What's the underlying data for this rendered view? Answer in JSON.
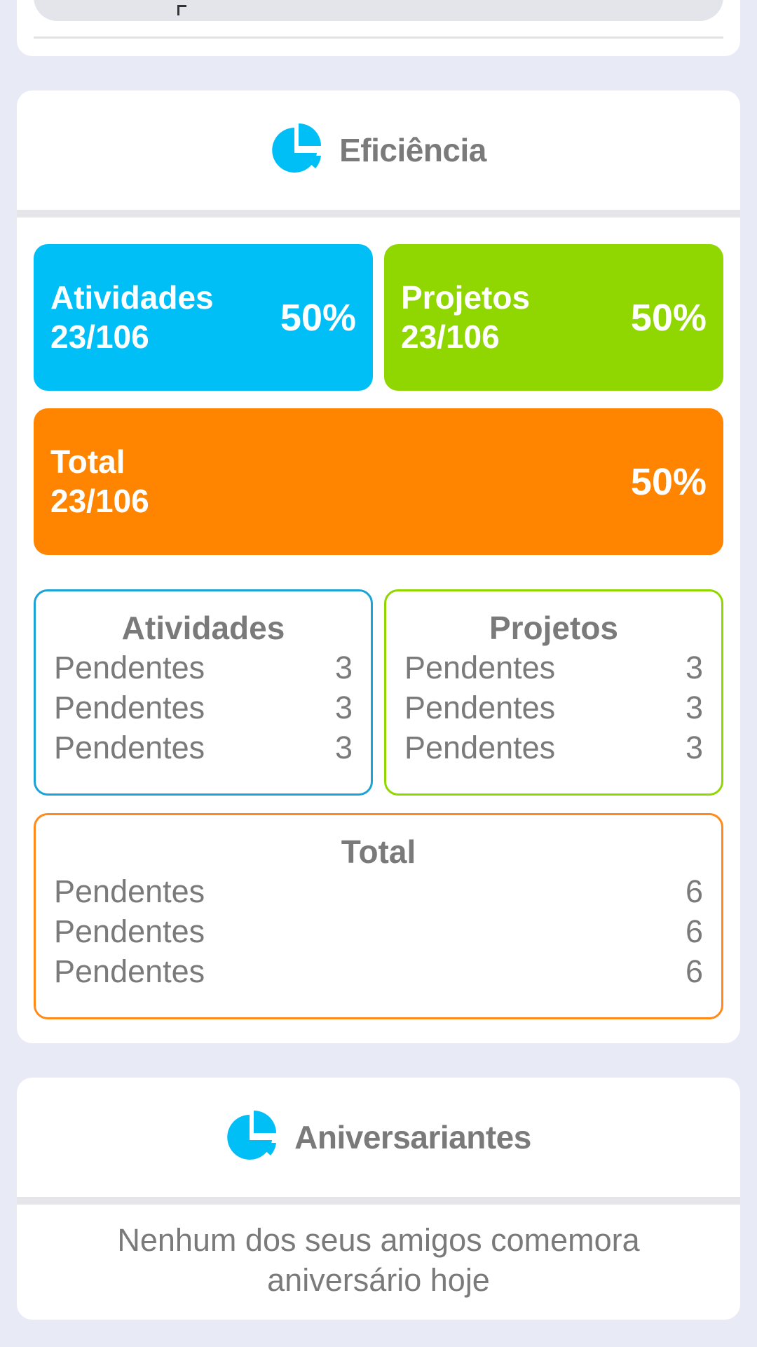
{
  "colors": {
    "background": "#e8eaf6",
    "atividades": "#00bff7",
    "projetos": "#90d600",
    "total": "#ff8500",
    "text_gray": "#7a7a7a"
  },
  "efficiency": {
    "title": "Eficiência",
    "icon": "pie-chart-icon",
    "stats": {
      "atividades": {
        "label": "Atividades",
        "count": "23/106",
        "percent": "50%"
      },
      "projetos": {
        "label": "Projetos",
        "count": "23/106",
        "percent": "50%"
      },
      "total": {
        "label": "Total",
        "count": "23/106",
        "percent": "50%"
      }
    },
    "breakdown": {
      "atividades": {
        "title": "Atividades",
        "rows": [
          {
            "label": "Pendentes",
            "value": "3"
          },
          {
            "label": "Pendentes",
            "value": "3"
          },
          {
            "label": "Pendentes",
            "value": "3"
          }
        ]
      },
      "projetos": {
        "title": "Projetos",
        "rows": [
          {
            "label": "Pendentes",
            "value": "3"
          },
          {
            "label": "Pendentes",
            "value": "3"
          },
          {
            "label": "Pendentes",
            "value": "3"
          }
        ]
      },
      "total": {
        "title": "Total",
        "rows": [
          {
            "label": "Pendentes",
            "value": "6"
          },
          {
            "label": "Pendentes",
            "value": "6"
          },
          {
            "label": "Pendentes",
            "value": "6"
          }
        ]
      }
    }
  },
  "birthdays": {
    "title": "Aniversariantes",
    "icon": "pie-chart-icon",
    "message_line1": "Nenhum dos seus amigos comemora",
    "message_line2": "aniversário hoje"
  }
}
